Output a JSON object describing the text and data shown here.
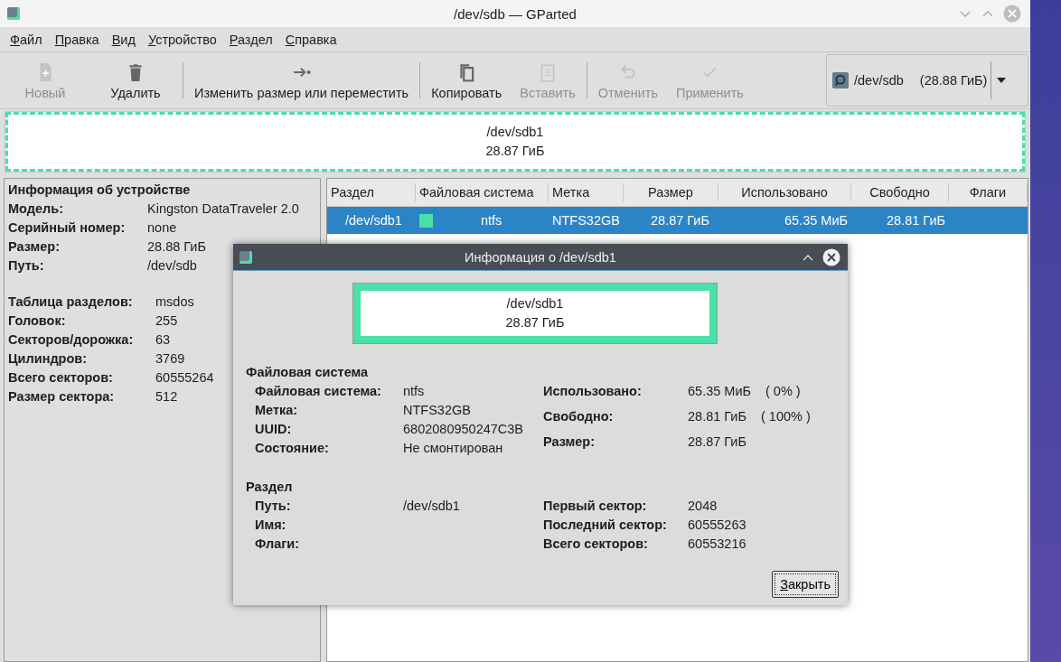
{
  "window": {
    "title": "/dev/sdb — GParted"
  },
  "menu": [
    "Файл",
    "Правка",
    "Вид",
    "Устройство",
    "Раздел",
    "Справка"
  ],
  "toolbar": [
    {
      "kind": "new",
      "label": "Новый",
      "disabled": true
    },
    {
      "kind": "delete",
      "label": "Удалить",
      "disabled": false
    },
    {
      "kind": "resize",
      "label": "Изменить размер или переместить",
      "disabled": false
    },
    {
      "kind": "copy",
      "label": "Копировать",
      "disabled": false
    },
    {
      "kind": "paste",
      "label": "Вставить",
      "disabled": true
    },
    {
      "kind": "undo",
      "label": "Отменить",
      "disabled": true
    },
    {
      "kind": "apply",
      "label": "Применить",
      "disabled": true
    }
  ],
  "device_selector": {
    "device": "/dev/sdb",
    "size": "(28.88 ГиБ)"
  },
  "partition_map": {
    "name": "/dev/sdb1",
    "size": "28.87 ГиБ",
    "color": "#4ae0a8"
  },
  "device_info": {
    "title": "Информация об устройстве",
    "groups": [
      [
        {
          "label": "Модель:",
          "value": "Kingston DataTraveler 2.0"
        },
        {
          "label": "Серийный номер:",
          "value": "none"
        },
        {
          "label": "Размер:",
          "value": "28.88 ГиБ"
        },
        {
          "label": "Путь:",
          "value": "/dev/sdb"
        }
      ],
      [
        {
          "label": "Таблица разделов:",
          "value": "msdos"
        },
        {
          "label": "Головок:",
          "value": "255"
        },
        {
          "label": "Секторов/дорожка:",
          "value": "63"
        },
        {
          "label": "Цилиндров:",
          "value": "3769"
        },
        {
          "label": "Всего секторов:",
          "value": "60555264"
        },
        {
          "label": "Размер сектора:",
          "value": "512"
        }
      ]
    ]
  },
  "table": {
    "columns": [
      "Раздел",
      "Файловая система",
      "Метка",
      "Размер",
      "Использовано",
      "Свободно",
      "Флаги"
    ],
    "rows": [
      {
        "selected": true,
        "partition": "/dev/sdb1",
        "color": "#4ae0a8",
        "filesystem": "ntfs",
        "label": "NTFS32GB",
        "size": "28.87 ГиБ",
        "used": "65.35 МиБ",
        "free": "28.81 ГиБ"
      }
    ]
  },
  "dialog": {
    "title": "Информация о /dev/sdb1",
    "map": {
      "name": "/dev/sdb1",
      "size": "28.87 ГиБ",
      "color": "#4ae0a8"
    },
    "sections": [
      {
        "title": "Файловая система",
        "left": [
          {
            "label": "Файловая система:",
            "value": "ntfs"
          },
          {
            "label": "Метка:",
            "value": "NTFS32GB"
          },
          {
            "label": "UUID:",
            "value": "6802080950247C3B"
          },
          {
            "label": "Состояние:",
            "value": "Не смонтирован"
          }
        ],
        "right": [
          {
            "label": "Использовано:",
            "value": "65.35 МиБ",
            "extra": "( 0% )"
          },
          {
            "label": "Свободно:",
            "value": "28.81 ГиБ",
            "extra": "( 100% )"
          },
          {
            "label": "Размер:",
            "value": "28.87 ГиБ"
          }
        ]
      },
      {
        "title": "Раздел",
        "left": [
          {
            "label": "Путь:",
            "value": "/dev/sdb1"
          },
          {
            "label": "Имя:"
          },
          {
            "label": "Флаги:"
          }
        ],
        "right": [
          {
            "label": "Первый сектор:",
            "value": "2048"
          },
          {
            "label": "Последний сектор:",
            "value": "60555263"
          },
          {
            "label": "Всего секторов:",
            "value": "60553216"
          }
        ]
      }
    ],
    "button": "Закрыть"
  }
}
